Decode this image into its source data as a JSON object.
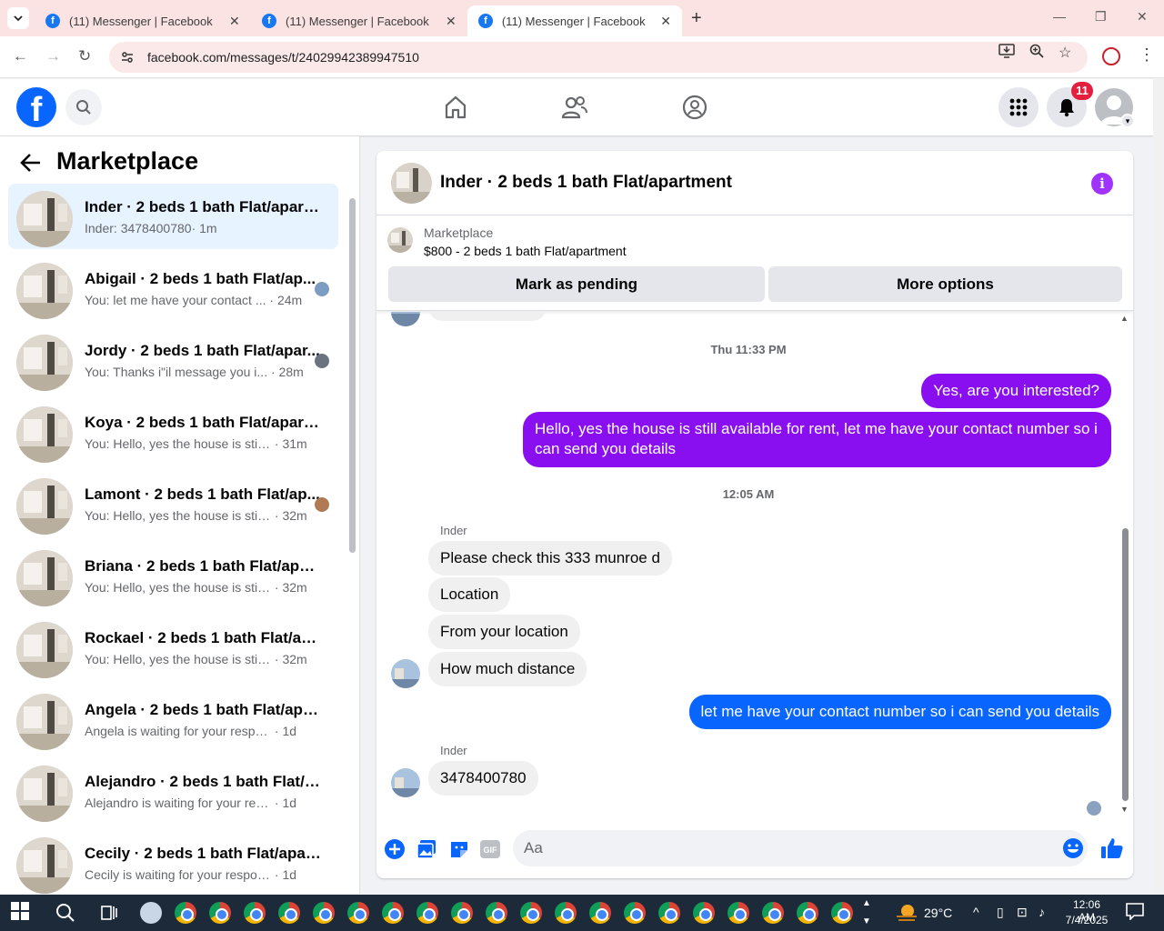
{
  "browser": {
    "tabs": [
      {
        "title": "(11) Messenger | Facebook"
      },
      {
        "title": "(11) Messenger | Facebook"
      },
      {
        "title": "(11) Messenger | Facebook"
      }
    ],
    "url": "facebook.com/messages/t/24029942389947510"
  },
  "fb": {
    "notifications_count": "11",
    "brand_color": "#0866ff"
  },
  "sidebar": {
    "title": "Marketplace",
    "conversations": [
      {
        "title": "Inder · 2 beds 1 bath Flat/apartm...",
        "snippet": "Inder: 3478400780",
        "time": "· 1m",
        "selected": true
      },
      {
        "title": "Abigail · 2 beds 1 bath Flat/ap...",
        "snippet": "You: let me have your contact ...",
        "time": " · 24m"
      },
      {
        "title": "Jordy · 2 beds 1 bath Flat/apar...",
        "snippet": "You: Thanks i\"il message you i...",
        "time": " · 28m"
      },
      {
        "title": "Koya · 2 beds 1 bath Flat/apartm...",
        "snippet": "You: Hello, yes the house is still av...",
        "time": " · 31m"
      },
      {
        "title": "Lamont · 2 beds 1 bath Flat/ap...",
        "snippet": "You: Hello, yes the house is still...",
        "time": " · 32m"
      },
      {
        "title": "Briana · 2 beds 1 bath Flat/apart...",
        "snippet": "You: Hello, yes the house is still av...",
        "time": " · 32m"
      },
      {
        "title": "Rockael · 2 beds 1 bath Flat/apar...",
        "snippet": "You: Hello, yes the house is still av...",
        "time": " · 32m"
      },
      {
        "title": "Angela · 2 beds 1 bath Flat/apart...",
        "snippet": "Angela is waiting for your response.",
        "time": " · 1d"
      },
      {
        "title": "Alejandro · 2 beds 1 bath Flat/ap...",
        "snippet": "Alejandro is waiting for your respo...",
        "time": " · 1d"
      },
      {
        "title": "Cecily · 2 beds 1 bath Flat/apart...",
        "snippet": "Cecily is waiting for your response.",
        "time": " · 1d"
      }
    ]
  },
  "chat": {
    "title": "Inder · 2 beds 1 bath Flat/apartment",
    "marketplace_label": "Marketplace",
    "listing": "$800 - 2 beds 1 bath Flat/apartment",
    "btn_pending": "Mark as pending",
    "btn_more": "More options",
    "timestamp1": "Thu 11:33 PM",
    "timestamp2": "12:05 AM",
    "sender_name": "Inder",
    "messages": {
      "out1": "Yes, are you interested?",
      "out2": "Hello, yes the house is still available for rent, let me have your contact number so i can send you details",
      "in1": "Please check this 333 munroe d",
      "in2": "Location",
      "in3": "From your location",
      "in4": "How much distance",
      "out3": "let me have your contact number so i can send you details",
      "in5": "3478400780"
    },
    "composer_placeholder": "Aa",
    "accent_purple": "#8a0ff0"
  },
  "taskbar": {
    "temperature": "29°C",
    "time": "12:06 AM",
    "date": "7/4/2025"
  }
}
